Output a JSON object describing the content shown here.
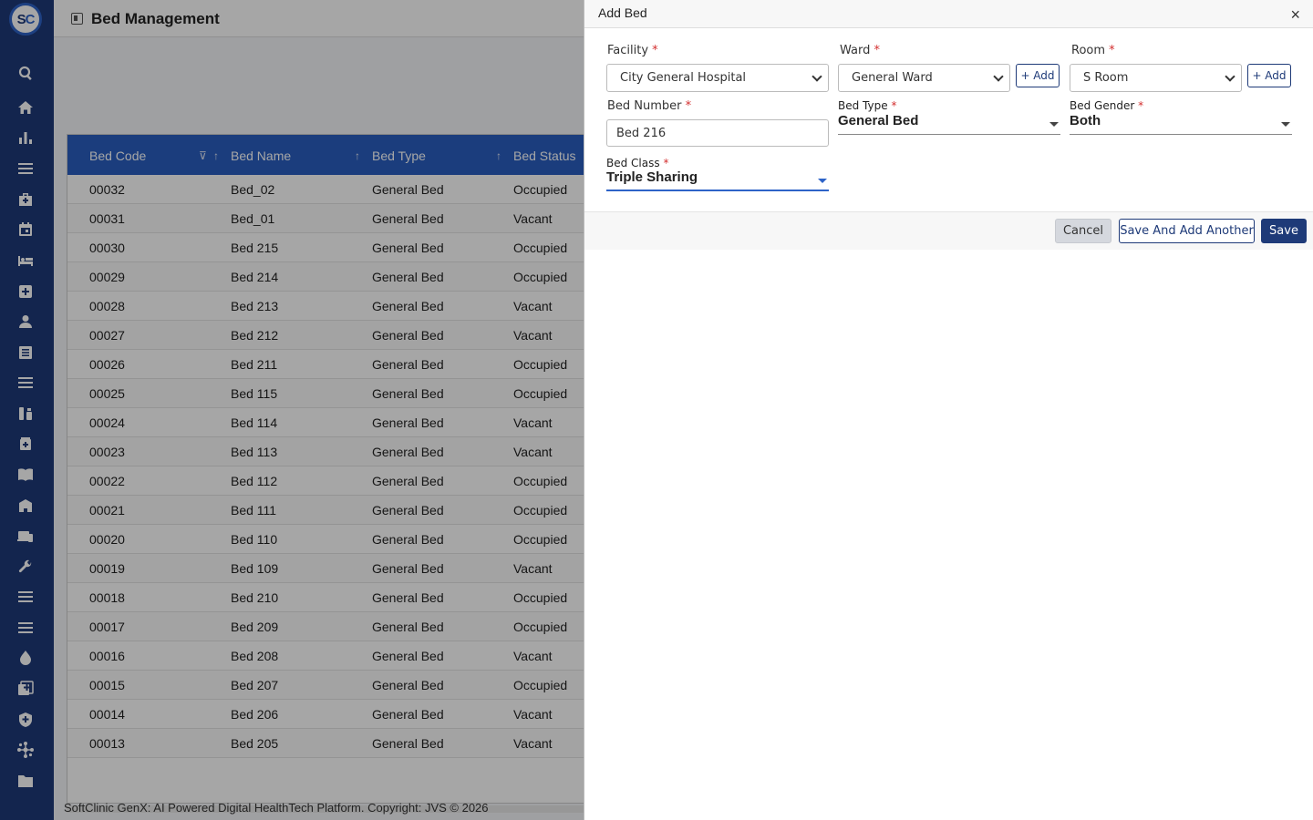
{
  "app": {
    "logo_text_s": "S",
    "logo_text_c": "C",
    "page_title": "Bed Management",
    "footer": "SoftClinic GenX: AI Powered Digital HealthTech Platform. Copyright: JVS © 2026"
  },
  "sidebar": {
    "icons": [
      "search-icon",
      "home-icon",
      "chart-icon",
      "menu-icon",
      "medical-bag-icon",
      "calendar-icon",
      "bed-icon",
      "medical-plus-icon",
      "person-icon",
      "list-icon",
      "menu-icon",
      "pharmacy-icon",
      "medicine-box-icon",
      "book-icon",
      "building-icon",
      "devices-icon",
      "wrench-icon",
      "menu-icon",
      "menu-icon",
      "drop-icon",
      "add-box-icon",
      "shield-icon",
      "network-icon",
      "folder-icon"
    ]
  },
  "table": {
    "columns": [
      "Bed Code",
      "Bed Name",
      "Bed Type",
      "Bed Status"
    ],
    "rows": [
      [
        "00032",
        "Bed_02",
        "General Bed",
        "Occupied"
      ],
      [
        "00031",
        "Bed_01",
        "General Bed",
        "Vacant"
      ],
      [
        "00030",
        "Bed 215",
        "General Bed",
        "Occupied"
      ],
      [
        "00029",
        "Bed 214",
        "General Bed",
        "Occupied"
      ],
      [
        "00028",
        "Bed 213",
        "General Bed",
        "Vacant"
      ],
      [
        "00027",
        "Bed 212",
        "General Bed",
        "Vacant"
      ],
      [
        "00026",
        "Bed 211",
        "General Bed",
        "Occupied"
      ],
      [
        "00025",
        "Bed 115",
        "General Bed",
        "Occupied"
      ],
      [
        "00024",
        "Bed 114",
        "General Bed",
        "Vacant"
      ],
      [
        "00023",
        "Bed 113",
        "General Bed",
        "Vacant"
      ],
      [
        "00022",
        "Bed 112",
        "General Bed",
        "Occupied"
      ],
      [
        "00021",
        "Bed 111",
        "General Bed",
        "Occupied"
      ],
      [
        "00020",
        "Bed 110",
        "General Bed",
        "Occupied"
      ],
      [
        "00019",
        "Bed 109",
        "General Bed",
        "Vacant"
      ],
      [
        "00018",
        "Bed 210",
        "General Bed",
        "Occupied"
      ],
      [
        "00017",
        "Bed 209",
        "General Bed",
        "Occupied"
      ],
      [
        "00016",
        "Bed 208",
        "General Bed",
        "Vacant"
      ],
      [
        "00015",
        "Bed 207",
        "General Bed",
        "Occupied"
      ],
      [
        "00014",
        "Bed 206",
        "General Bed",
        "Vacant"
      ],
      [
        "00013",
        "Bed 205",
        "General Bed",
        "Vacant"
      ]
    ]
  },
  "modal": {
    "title": "Add Bed",
    "close_glyph": "×",
    "facility": {
      "label": "Facility",
      "required": "*",
      "value": "City General Hospital"
    },
    "ward": {
      "label": "Ward",
      "required": "*",
      "value": "General Ward",
      "add_label": "+ Add"
    },
    "room": {
      "label": "Room",
      "required": "*",
      "value": "S Room",
      "add_label": "+ Add"
    },
    "bed_number": {
      "label": "Bed Number",
      "required": "*",
      "value": "Bed 216"
    },
    "bed_type": {
      "label": "Bed Type",
      "required": "*",
      "value": "General Bed"
    },
    "bed_gender": {
      "label": "Bed Gender",
      "required": "*",
      "value": "Both"
    },
    "bed_class": {
      "label": "Bed Class",
      "required": "*",
      "value": "Triple Sharing"
    },
    "actions": {
      "cancel": "Cancel",
      "save_another": "Save And Add Another",
      "save": "Save"
    }
  },
  "colors": {
    "sidebar": "#1e3a78",
    "table_header": "#2a5fc1",
    "primary_button": "#1e3a78",
    "required": "#d32f2f"
  }
}
